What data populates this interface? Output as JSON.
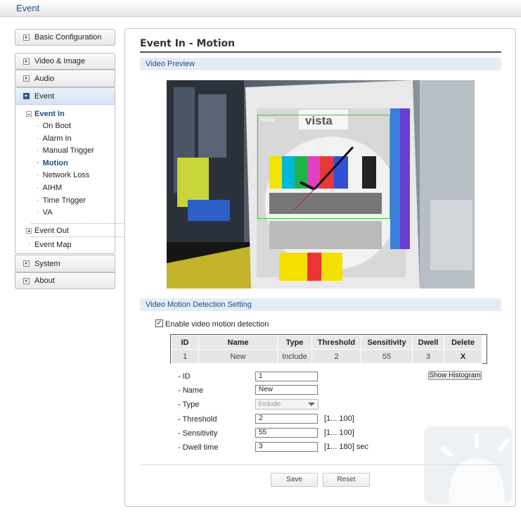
{
  "window": {
    "title": "Event"
  },
  "sidebar": {
    "basic_configuration": "Basic Configuration",
    "video_image": "Video & Image",
    "audio": "Audio",
    "event": {
      "label": "Event",
      "event_in": "Event In",
      "event_in_items": [
        "On Boot",
        "Alarm In",
        "Manual Trigger",
        "Motion",
        "Network Loss",
        "AIHM",
        "Time Trigger",
        "VA"
      ],
      "active_item": "Motion",
      "event_out": "Event Out",
      "event_map": "Event Map"
    },
    "system": "System",
    "about": "About"
  },
  "page": {
    "title": "Event In - Motion",
    "video_preview_section": "Video Preview",
    "motion_region_label": "New",
    "detection_section": "Video Motion Detection Setting",
    "enable_label": "Enable video motion detection",
    "enable_checked": true,
    "table": {
      "headers": [
        "ID",
        "Name",
        "Type",
        "Threshold",
        "Sensitivity",
        "Dwell",
        "Delete"
      ],
      "rows": [
        [
          "1",
          "New",
          "Include",
          "2",
          "55",
          "3",
          "X"
        ]
      ]
    },
    "form": {
      "id_label": "- ID",
      "id_value": "1",
      "name_label": "- Name",
      "name_value": "New",
      "type_label": "- Type",
      "type_value": "Include",
      "threshold_label": "- Threshold",
      "threshold_value": "2",
      "threshold_range": "[1... 100]",
      "sensitivity_label": "- Sensitivity",
      "sensitivity_value": "55",
      "sensitivity_range": "[1... 100]",
      "dwell_label": "- Dwell time",
      "dwell_value": "3",
      "dwell_range": "[1... 180] sec"
    },
    "show_histogram": "Show Histogram",
    "save": "Save",
    "reset": "Reset"
  },
  "preview": {
    "brand_text": "vista"
  }
}
